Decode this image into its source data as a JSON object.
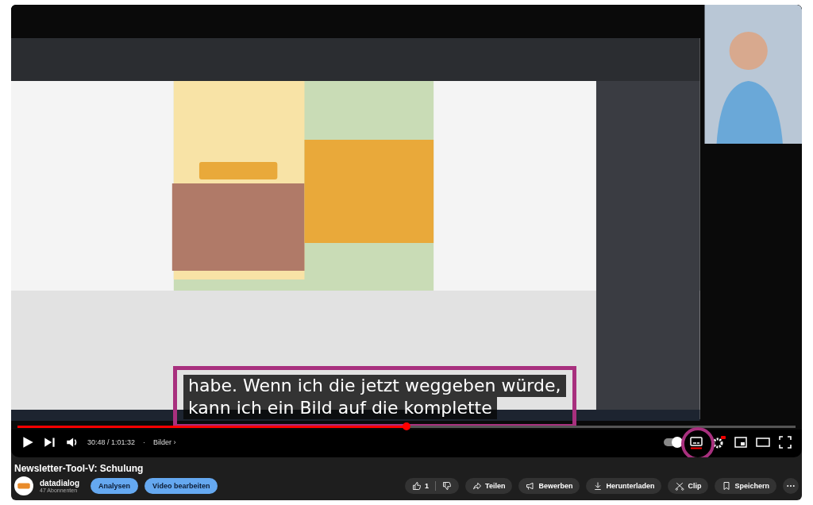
{
  "player": {
    "captions": [
      "habe. Wenn ich die jetzt weggeben würde,",
      "kann ich ein Bild auf die komplette"
    ],
    "progress": {
      "level": 0.5
    },
    "time": "30:48 / 1:01:32",
    "separator": "·",
    "chapter": "Bilder",
    "chapter_arrow": "›",
    "autoplay_on": true,
    "captions_on": true,
    "settings_badge": true
  },
  "video": {
    "title": "Newsletter-Tool-V: Schulung"
  },
  "channel": {
    "name": "datadialog",
    "subscribers": "47 Abonnenten"
  },
  "owner_buttons": [
    "Analysen",
    "Video bearbeiten"
  ],
  "actions": [
    {
      "kind": "like",
      "label": "1"
    },
    {
      "kind": "share",
      "label": "Teilen"
    },
    {
      "kind": "promote",
      "label": "Bewerben"
    },
    {
      "kind": "download",
      "label": "Herunterladen"
    },
    {
      "kind": "clip",
      "label": "Clip"
    },
    {
      "kind": "save",
      "label": "Speichern"
    },
    {
      "kind": "more"
    }
  ]
}
